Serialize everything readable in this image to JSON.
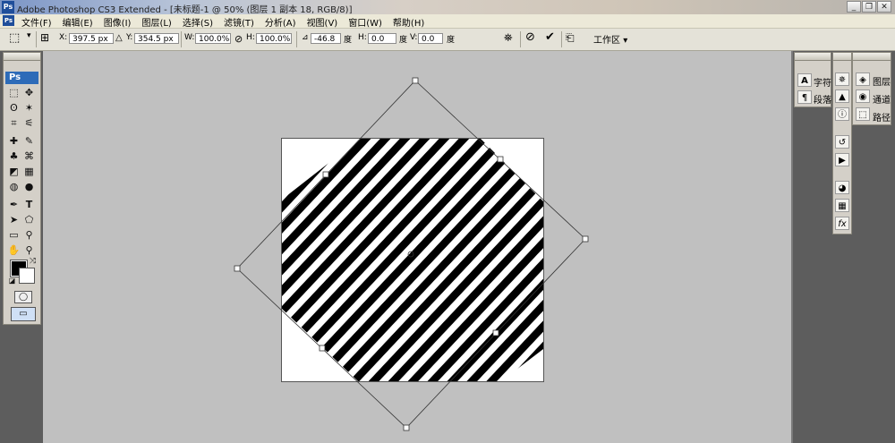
{
  "window": {
    "title": "Adobe Photoshop CS3 Extended - [未标题-1 @ 50% (图层 1 副本 18, RGB/8)]",
    "app_icon": "Ps",
    "controls": [
      "minimize-icon",
      "restore-icon",
      "close-icon"
    ]
  },
  "menu": {
    "items": [
      "文件(F)",
      "编辑(E)",
      "图像(I)",
      "图层(L)",
      "选择(S)",
      "滤镜(T)",
      "分析(A)",
      "视图(V)",
      "窗口(W)",
      "帮助(H)"
    ]
  },
  "options": {
    "x_label": "X:",
    "x_value": "397.5 px",
    "y_label": "Y:",
    "y_value": "354.5 px",
    "w_label": "W:",
    "w_value": "100.0%",
    "h_label": "H:",
    "h_value": "100.0%",
    "angle_value": "-46.8",
    "degree_unit": "度",
    "hskew_label": "H:",
    "hskew_value": "0.0",
    "vskew_label": "V:",
    "vskew_value": "0.0",
    "workspace_label": "工作区"
  },
  "toolbox": {
    "logo": "Ps",
    "tools": [
      "marquee-icon",
      "move-icon",
      "lasso-icon",
      "magic-wand-icon",
      "crop-icon",
      "slice-icon",
      "healing-brush-icon",
      "brush-icon",
      "clone-stamp-icon",
      "history-brush-icon",
      "eraser-icon",
      "gradient-icon",
      "blur-icon",
      "dodge-icon",
      "pen-icon",
      "type-icon",
      "path-selection-icon",
      "shape-icon",
      "notes-icon",
      "eyedropper-icon",
      "hand-icon",
      "zoom-icon"
    ],
    "foreground_color": "#000000",
    "background_color": "#ffffff"
  },
  "canvas": {
    "document_background": "#ffffff",
    "stripe_color": "#000000",
    "stripe_angle_deg": -46.8
  },
  "panels": {
    "left_dock": [
      {
        "icon": "character-icon",
        "label": "字符"
      },
      {
        "icon": "paragraph-icon",
        "label": "段落"
      }
    ],
    "right_dock": [
      {
        "icon": "layers-icon",
        "label": "图层"
      },
      {
        "icon": "channels-icon",
        "label": "通道"
      },
      {
        "icon": "paths-icon",
        "label": "路径"
      }
    ],
    "mid_icons": [
      "navigator-icon",
      "histogram-icon",
      "info-icon",
      "history-icon",
      "actions-icon",
      "swatches-icon",
      "styles-icon",
      "fx-icon"
    ]
  }
}
